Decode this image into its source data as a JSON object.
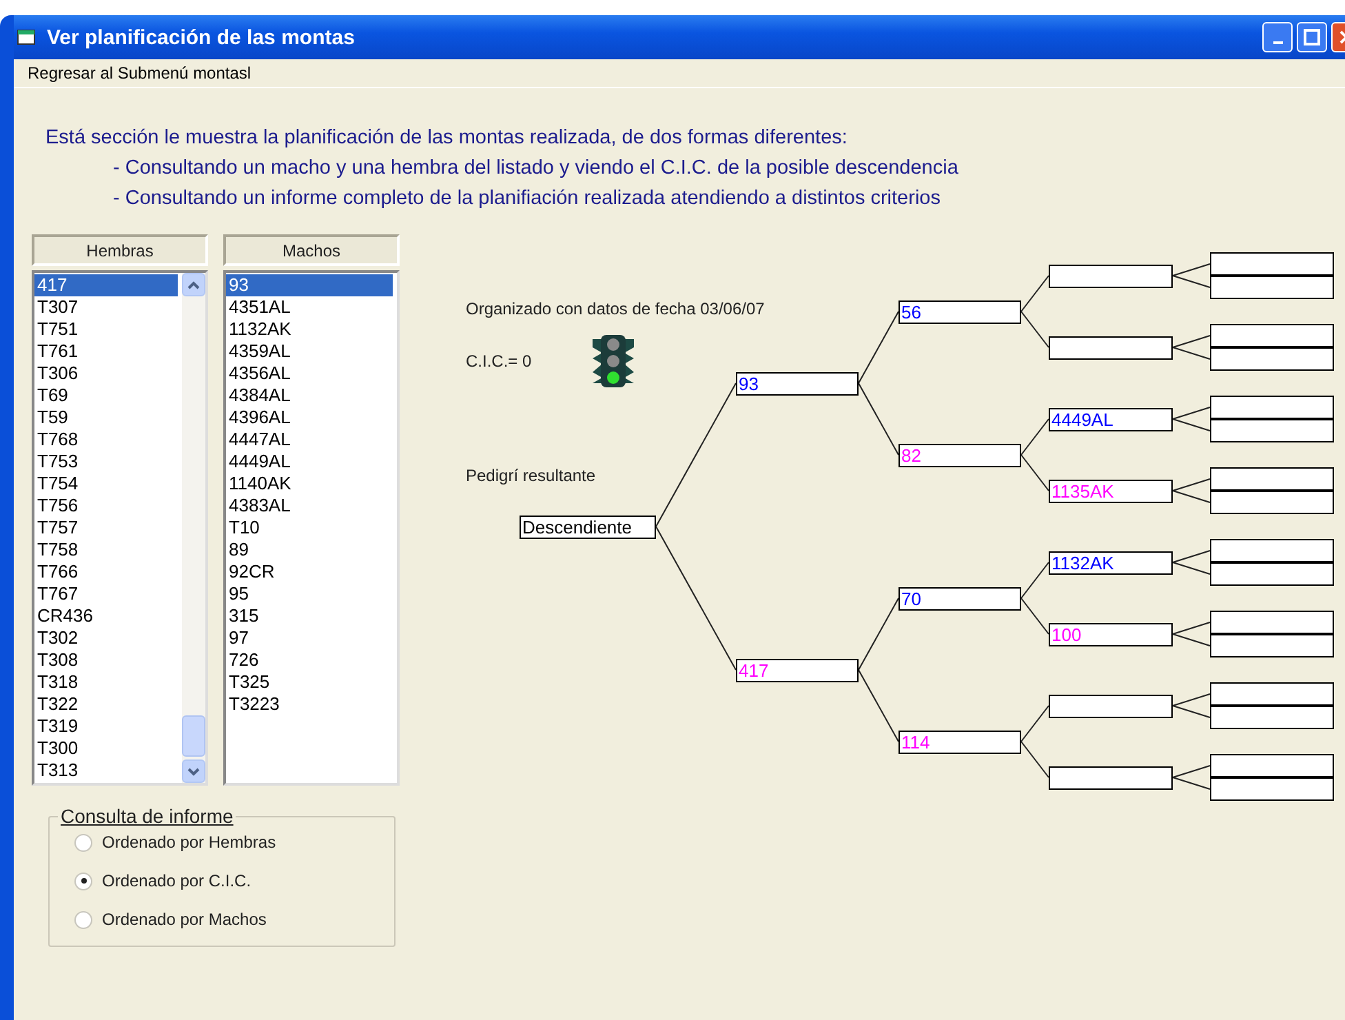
{
  "window": {
    "title": "Ver planificación de las montas"
  },
  "menu": [
    "Regresar al Submenú montasl"
  ],
  "intro": {
    "heading": "Está sección le muestra la planificación de las montas realizada, de dos formas diferentes:",
    "bullets": [
      "- Consultando un macho y una hembra del listado y viendo el C.I.C. de la posible descendencia",
      "- Consultando un informe completo de la planifiación realizada atendiendo a distintos criterios"
    ]
  },
  "lists": [
    {
      "title": "Hembras",
      "items": [
        {
          "label": "417",
          "selected": true
        },
        {
          "label": "T307",
          "selected": false
        },
        {
          "label": "T751",
          "selected": false
        },
        {
          "label": "T761",
          "selected": false
        },
        {
          "label": "T306",
          "selected": false
        },
        {
          "label": "T69",
          "selected": false
        },
        {
          "label": "T59",
          "selected": false
        },
        {
          "label": "T768",
          "selected": false
        },
        {
          "label": "T753",
          "selected": false
        },
        {
          "label": "T754",
          "selected": false
        },
        {
          "label": "T756",
          "selected": false
        },
        {
          "label": "T757",
          "selected": false
        },
        {
          "label": "T758",
          "selected": false
        },
        {
          "label": "T766",
          "selected": false
        },
        {
          "label": "T767",
          "selected": false
        },
        {
          "label": "CR436",
          "selected": false
        },
        {
          "label": "T302",
          "selected": false
        },
        {
          "label": "T308",
          "selected": false
        },
        {
          "label": "T318",
          "selected": false
        },
        {
          "label": "T322",
          "selected": false
        },
        {
          "label": "T319",
          "selected": false
        },
        {
          "label": "T300",
          "selected": false
        },
        {
          "label": "T313",
          "selected": false
        }
      ]
    },
    {
      "title": "Machos",
      "items": [
        {
          "label": "93",
          "selected": true
        },
        {
          "label": "4351AL",
          "selected": false
        },
        {
          "label": "1132AK",
          "selected": false
        },
        {
          "label": "4359AL",
          "selected": false
        },
        {
          "label": "4356AL",
          "selected": false
        },
        {
          "label": "4384AL",
          "selected": false
        },
        {
          "label": "4396AL",
          "selected": false
        },
        {
          "label": "4447AL",
          "selected": false
        },
        {
          "label": "4449AL",
          "selected": false
        },
        {
          "label": "1140AK",
          "selected": false
        },
        {
          "label": "4383AL",
          "selected": false
        },
        {
          "label": "T10",
          "selected": false
        },
        {
          "label": "89",
          "selected": false
        },
        {
          "label": "92CR",
          "selected": false
        },
        {
          "label": "95",
          "selected": false
        },
        {
          "label": "315",
          "selected": false
        },
        {
          "label": "97",
          "selected": false
        },
        {
          "label": "726",
          "selected": false
        },
        {
          "label": "T325",
          "selected": false
        },
        {
          "label": "T3223",
          "selected": false
        }
      ]
    }
  ],
  "report": {
    "title": "Consulta de  informe",
    "options": [
      {
        "label": "Ordenado por Hembras",
        "selected": false
      },
      {
        "label": "Ordenado por C.I.C.",
        "selected": true
      },
      {
        "label": "Ordenado por Machos",
        "selected": false
      }
    ]
  },
  "pedigree": {
    "date_note": "Organizado con datos de fecha 03/06/07",
    "cic": "C.I.C.= 0",
    "caption": "Pedigrí resultante",
    "tree": {
      "label": "Descendiente",
      "children": [
        {
          "label": "93",
          "color": "#0000ff",
          "children": [
            {
              "label": "56",
              "color": "#0000ff"
            },
            {
              "label": "82",
              "color": "#ff00ff",
              "children": [
                {
                  "label": "4449AL",
                  "color": "#0000ff"
                },
                {
                  "label": "1135AK",
                  "color": "#ff00ff"
                }
              ]
            }
          ]
        },
        {
          "label": "417",
          "color": "#ff00ff",
          "children": [
            {
              "label": "70",
              "color": "#0000ff",
              "children": [
                {
                  "label": "1132AK",
                  "color": "#0000ff"
                },
                {
                  "label": "100",
                  "color": "#ff00ff"
                }
              ]
            },
            {
              "label": "114",
              "color": "#ff00ff"
            }
          ]
        }
      ]
    }
  }
}
